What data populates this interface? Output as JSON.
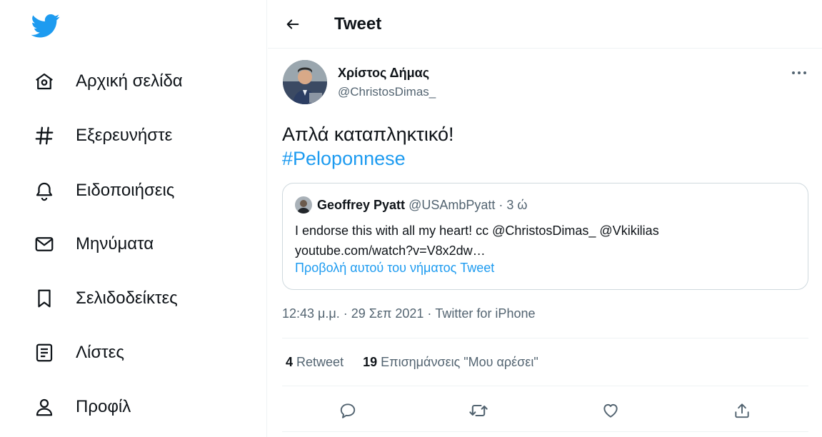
{
  "sidebar": {
    "items": [
      {
        "label": "Αρχική σελίδα",
        "icon": "home-icon"
      },
      {
        "label": "Εξερευνήστε",
        "icon": "hashtag-icon"
      },
      {
        "label": "Ειδοποιήσεις",
        "icon": "bell-icon"
      },
      {
        "label": "Μηνύματα",
        "icon": "mail-icon"
      },
      {
        "label": "Σελιδοδείκτες",
        "icon": "bookmark-icon"
      },
      {
        "label": "Λίστες",
        "icon": "list-icon"
      },
      {
        "label": "Προφίλ",
        "icon": "profile-icon"
      }
    ]
  },
  "header": {
    "title": "Tweet"
  },
  "tweet": {
    "author_name": "Χρίστος Δήμας",
    "author_handle": "@ChristosDimas_",
    "text": "Απλά καταπληκτικό!",
    "hashtag": "#Peloponnese",
    "timestamp": "12:43 μ.μ. · 29 Σεπ 2021",
    "separator": " · ",
    "source": "Twitter for iPhone",
    "retweets_count": "4",
    "retweets_label": "Retweet",
    "likes_count": "19",
    "likes_label": "Επισημάνσεις \"Μου αρέσει\""
  },
  "quote": {
    "author_name": "Geoffrey Pyatt",
    "author_handle": "@USAmbPyatt",
    "dot": "·",
    "time": "3 ώ",
    "text_line1": "I endorse this with all my heart!  cc @ChristosDimas_ @Vkikilias",
    "text_line2": "youtube.com/watch?v=V8x2dw…",
    "show_thread": "Προβολή αυτού του νήματος Tweet"
  },
  "colors": {
    "accent": "#1d9bf0",
    "text": "#0f1419",
    "secondary": "#536471",
    "border": "#eff3f4"
  }
}
